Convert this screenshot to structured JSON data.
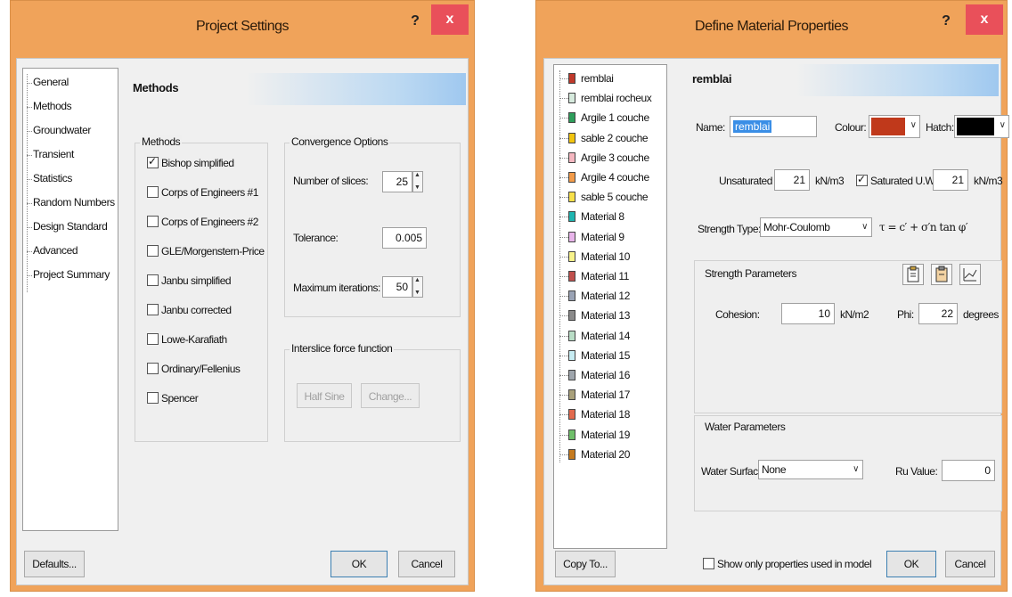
{
  "project_settings": {
    "title": "Project Settings",
    "help": "?",
    "close": "x",
    "nav": [
      "General",
      "Methods",
      "Groundwater",
      "Transient",
      "Statistics",
      "Random Numbers",
      "Design Standard",
      "Advanced",
      "Project Summary"
    ],
    "section_title": "Methods",
    "methods_group": "Methods",
    "methods": [
      {
        "label": "Bishop simplified",
        "checked": true
      },
      {
        "label": "Corps of Engineers #1",
        "checked": false
      },
      {
        "label": "Corps of Engineers #2",
        "checked": false
      },
      {
        "label": "GLE/Morgenstern-Price",
        "checked": false
      },
      {
        "label": "Janbu simplified",
        "checked": false
      },
      {
        "label": "Janbu corrected",
        "checked": false
      },
      {
        "label": "Lowe-Karafiath",
        "checked": false
      },
      {
        "label": "Ordinary/Fellenius",
        "checked": false
      },
      {
        "label": "Spencer",
        "checked": false
      }
    ],
    "convergence_group": "Convergence Options",
    "slices_label": "Number of slices:",
    "slices_value": "25",
    "tolerance_label": "Tolerance:",
    "tolerance_value": "0.005",
    "iterations_label": "Maximum iterations:",
    "iterations_value": "50",
    "interslice_group": "Interslice force function",
    "half_sine": "Half Sine",
    "change": "Change...",
    "defaults": "Defaults...",
    "ok": "OK",
    "cancel": "Cancel"
  },
  "material_props": {
    "title": "Define Material Properties",
    "help": "?",
    "close": "x",
    "materials": [
      {
        "name": "remblai",
        "color": "#c0392b"
      },
      {
        "name": "remblai rocheux",
        "color": "#d6eadd"
      },
      {
        "name": "Argile 1 couche",
        "color": "#2e9e5b"
      },
      {
        "name": "sable 2 couche",
        "color": "#f1c40f"
      },
      {
        "name": "Argile 3 couche",
        "color": "#f5b7c0"
      },
      {
        "name": "Argile 4 couche",
        "color": "#f39c4a"
      },
      {
        "name": "sable 5 couche",
        "color": "#f7e04a"
      },
      {
        "name": "Material 8",
        "color": "#1fb5b0"
      },
      {
        "name": "Material 9",
        "color": "#e8b4ea"
      },
      {
        "name": "Material 10",
        "color": "#f7f28a"
      },
      {
        "name": "Material 11",
        "color": "#c0504d"
      },
      {
        "name": "Material 12",
        "color": "#9aa3b5"
      },
      {
        "name": "Material 13",
        "color": "#8a8a8a"
      },
      {
        "name": "Material 14",
        "color": "#b9ddc6"
      },
      {
        "name": "Material 15",
        "color": "#c7ecf2"
      },
      {
        "name": "Material 16",
        "color": "#9fa6ad"
      },
      {
        "name": "Material 17",
        "color": "#a8a07a"
      },
      {
        "name": "Material 18",
        "color": "#e26a4e"
      },
      {
        "name": "Material 19",
        "color": "#6fbf6a"
      },
      {
        "name": "Material 20",
        "color": "#c57a1e"
      }
    ],
    "section_title": "remblai",
    "name_label": "Name:",
    "name_value": "remblai",
    "colour_label": "Colour:",
    "colour_value": "#c0391b",
    "hatch_label": "Hatch:",
    "unsat_label": "Unsaturated U.W.:",
    "unsat_value": "21",
    "unsat_unit": "kN/m3",
    "sat_label": "Saturated U.W.:",
    "sat_value": "21",
    "sat_unit": "kN/m3",
    "strength_type_label": "Strength Type:",
    "strength_type_value": "Mohr-Coulomb",
    "formula": "τ = c′ + σ′n tan φ′",
    "strength_group": "Strength Parameters",
    "cohesion_label": "Cohesion:",
    "cohesion_value": "10",
    "cohesion_unit": "kN/m2",
    "phi_label": "Phi:",
    "phi_value": "22",
    "phi_unit": "degrees",
    "water_group": "Water Parameters",
    "water_surface_label": "Water Surface:",
    "water_surface_value": "None",
    "ru_label": "Ru Value:",
    "ru_value": "0",
    "copy_to": "Copy To...",
    "show_only": "Show only properties used in model",
    "ok": "OK",
    "cancel": "Cancel"
  }
}
